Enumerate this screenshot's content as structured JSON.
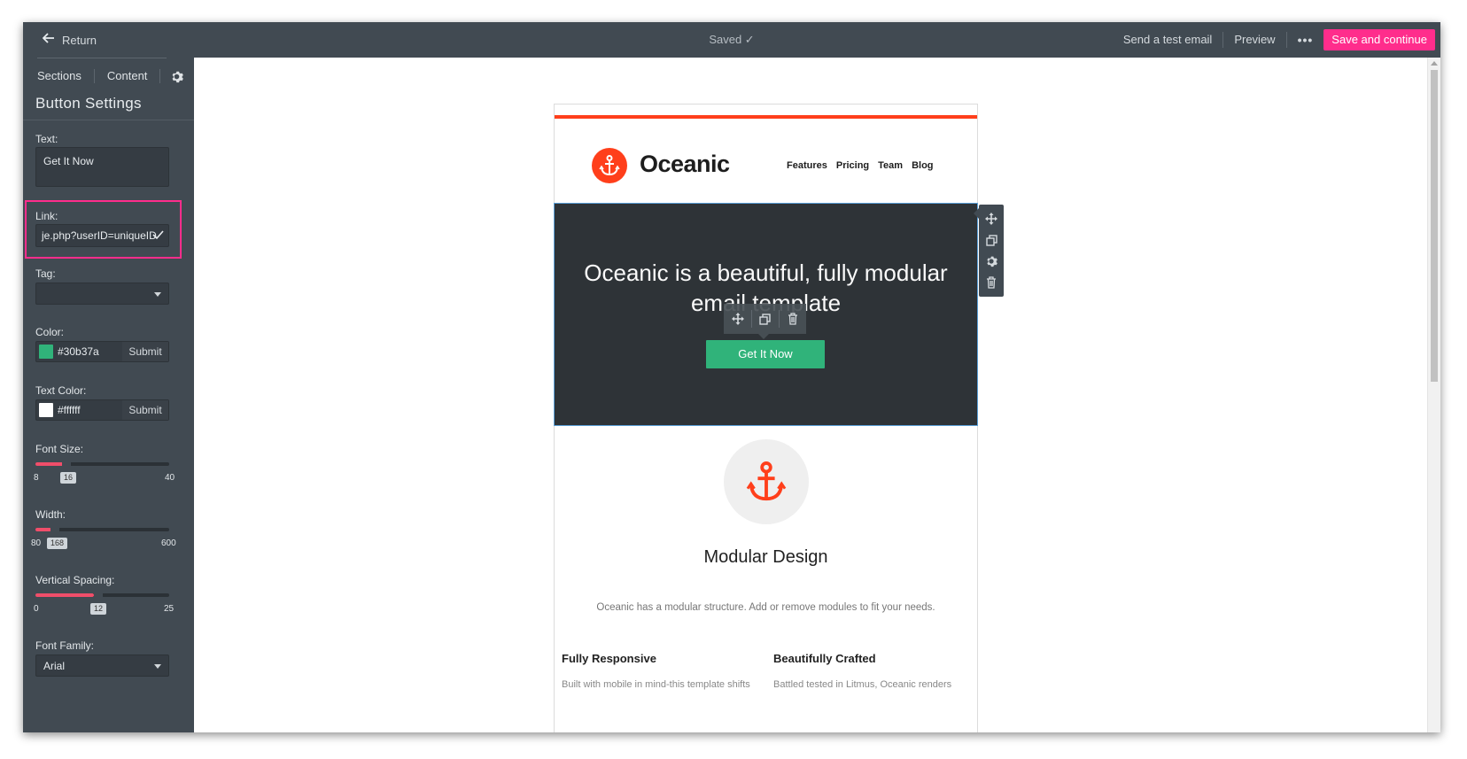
{
  "topbar": {
    "return_label": "Return",
    "status": "Saved ✓",
    "send_test": "Send a test email",
    "preview": "Preview",
    "more": "•••",
    "save_continue": "Save and continue"
  },
  "sidebar": {
    "tabs": {
      "sections": "Sections",
      "content": "Content"
    },
    "title": "Button Settings",
    "text": {
      "label": "Text:",
      "value": "Get It Now"
    },
    "link": {
      "label": "Link:",
      "value": "je.php?userID=uniqueID"
    },
    "tag": {
      "label": "Tag:",
      "value": ""
    },
    "color": {
      "label": "Color:",
      "value": "#30b37a",
      "swatch": "#30b37a",
      "submit": "Submit"
    },
    "text_color": {
      "label": "Text Color:",
      "value": "#ffffff",
      "swatch": "#ffffff",
      "submit": "Submit"
    },
    "font_size": {
      "label": "Font Size:",
      "min": "8",
      "max": "40",
      "value": "16"
    },
    "width": {
      "label": "Width:",
      "min": "80",
      "max": "600",
      "value": "168"
    },
    "vertical_spacing": {
      "label": "Vertical Spacing:",
      "min": "0",
      "max": "25",
      "value": "12"
    },
    "font_family": {
      "label": "Font Family:",
      "value": "Arial"
    }
  },
  "email": {
    "brand": "Oceanic",
    "nav": [
      "Features",
      "Pricing",
      "Team",
      "Blog"
    ],
    "hero_title": "Oceanic is a beautiful, fully modular email template",
    "cta": "Get It Now",
    "feature_title": "Modular Design",
    "feature_desc": "Oceanic has a modular structure. Add or remove modules to fit your needs.",
    "col1_title": "Fully Responsive",
    "col1_text": "Built with mobile in mind-this template shifts",
    "col2_title": "Beautifully Crafted",
    "col2_text": "Battled tested in Litmus, Oceanic renders"
  },
  "colors": {
    "accent_pink": "#ff2d8c",
    "brand_orange": "#ff3f1b",
    "button_green": "#30b37a",
    "panel_dark": "#414a52",
    "hero_dark": "#2e3337"
  },
  "icons": [
    "arrow-left-icon",
    "gear-icon",
    "checkmark-icon",
    "move-icon",
    "duplicate-icon",
    "trash-icon",
    "anchor-icon",
    "chat-icon"
  ]
}
